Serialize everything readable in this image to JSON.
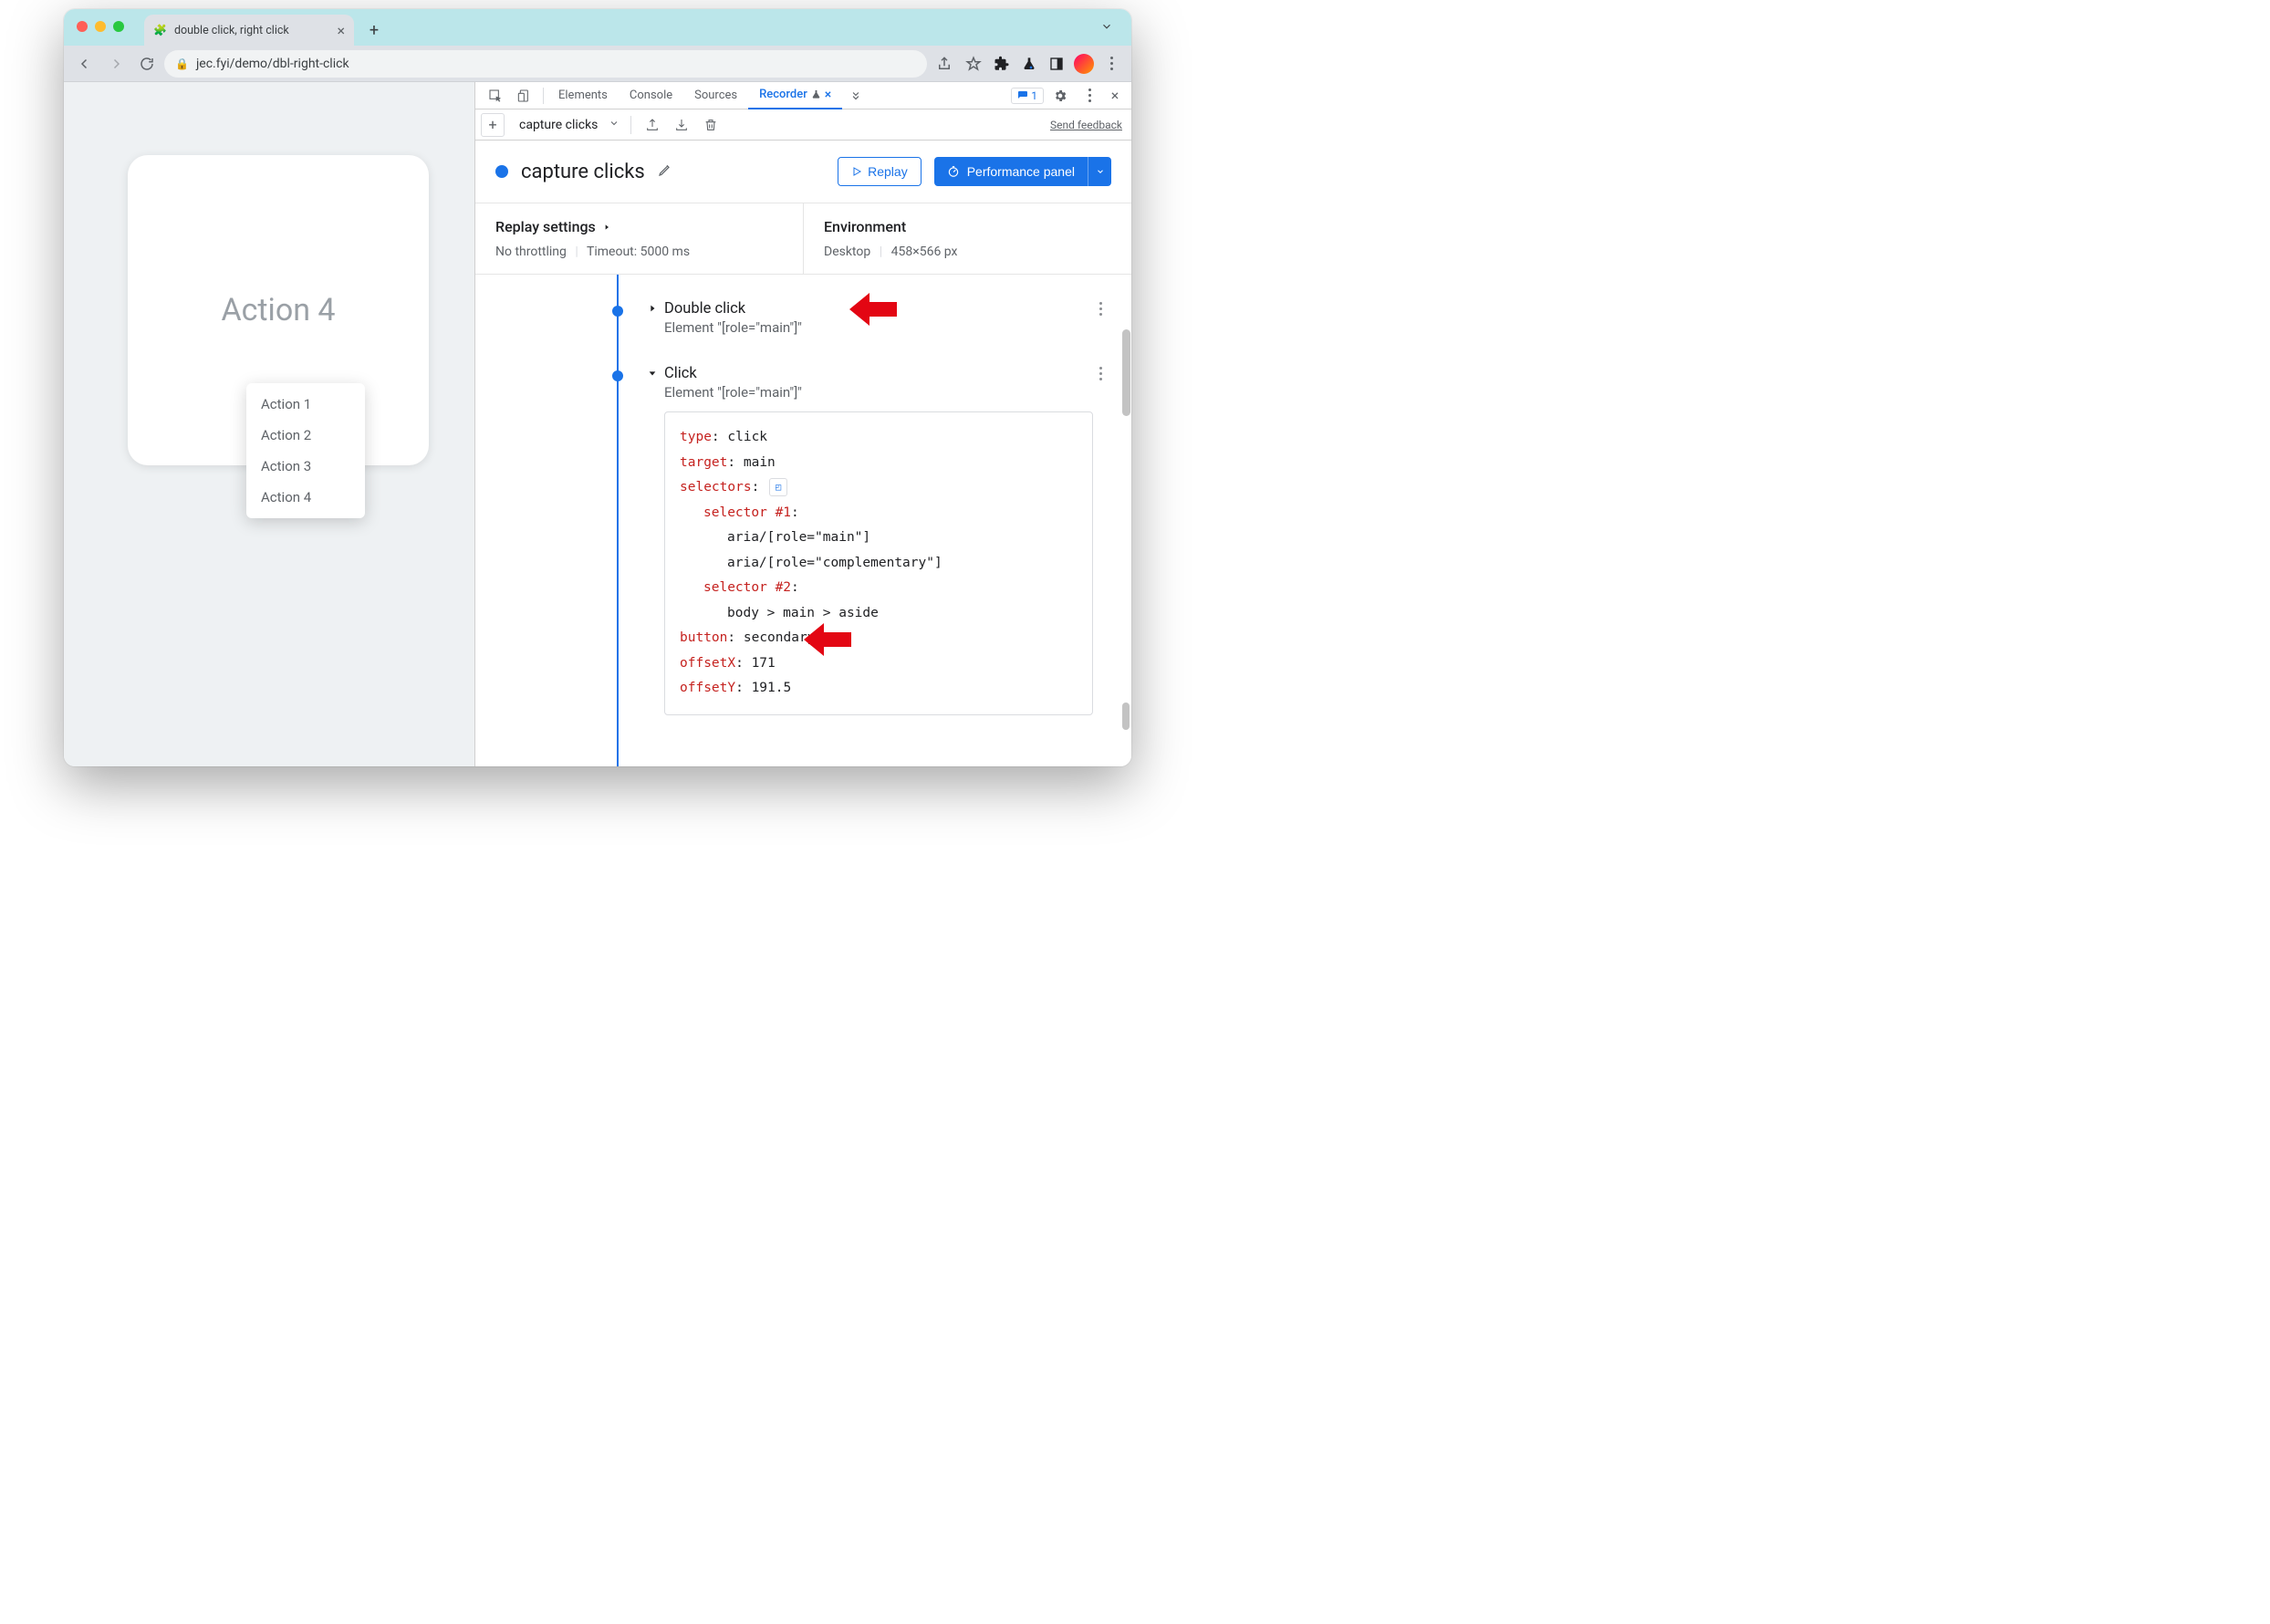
{
  "browser": {
    "tab_title": "double click, right click",
    "url": "jec.fyi/demo/dbl-right-click"
  },
  "page": {
    "card_text": "Action 4",
    "menu": [
      "Action 1",
      "Action 2",
      "Action 3",
      "Action 4"
    ]
  },
  "devtools": {
    "tabs": {
      "elements": "Elements",
      "console": "Console",
      "sources": "Sources",
      "recorder": "Recorder"
    },
    "issues_count": "1",
    "recorder": {
      "recording_name_small": "capture clicks",
      "send_feedback": "Send feedback",
      "title": "capture clicks",
      "replay_label": "Replay",
      "perf_label": "Performance panel",
      "replay_settings": {
        "title": "Replay settings",
        "throttling": "No throttling",
        "timeout": "Timeout: 5000 ms"
      },
      "environment": {
        "title": "Environment",
        "device": "Desktop",
        "viewport": "458×566 px"
      },
      "steps": [
        {
          "title": "Double click",
          "sub": "Element \"[role=\"main\"]\""
        },
        {
          "title": "Click",
          "sub": "Element \"[role=\"main\"]\"",
          "details": {
            "type": "click",
            "target": "main",
            "selectors_label": "selectors",
            "sel1_label": "selector #1",
            "sel1_a": "aria/[role=\"main\"]",
            "sel1_b": "aria/[role=\"complementary\"]",
            "sel2_label": "selector #2",
            "sel2_a": "body > main > aside",
            "button": "secondary",
            "offsetX": "171",
            "offsetY": "191.5"
          }
        }
      ]
    }
  }
}
